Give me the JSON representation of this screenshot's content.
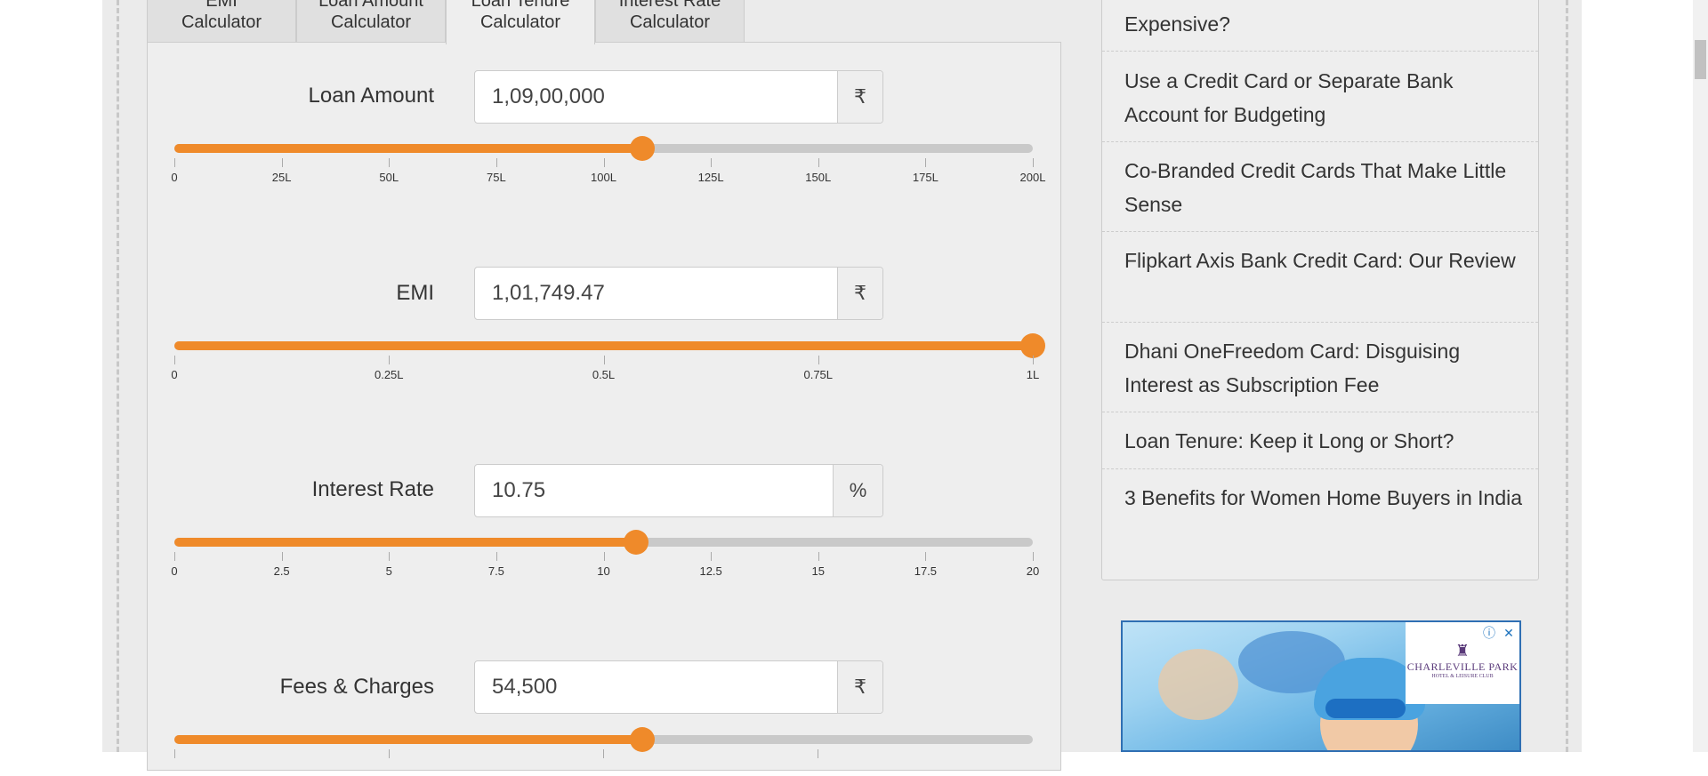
{
  "tabs": [
    {
      "label": "EMI Calculator"
    },
    {
      "label": "Loan Amount Calculator"
    },
    {
      "label": "Loan Tenure Calculator",
      "active": true
    },
    {
      "label": "Interest Rate Calculator"
    }
  ],
  "fields": {
    "loan_amount": {
      "label": "Loan Amount",
      "value": "1,09,00,000",
      "unit": "₹",
      "slider_fraction": 0.545,
      "ticks": [
        "0",
        "25L",
        "50L",
        "75L",
        "100L",
        "125L",
        "150L",
        "175L",
        "200L"
      ]
    },
    "emi": {
      "label": "EMI",
      "value": "1,01,749.47",
      "unit": "₹",
      "slider_fraction": 1.0,
      "ticks": [
        "0",
        "0.25L",
        "0.5L",
        "0.75L",
        "1L"
      ]
    },
    "interest_rate": {
      "label": "Interest Rate",
      "value": "10.75",
      "unit": "%",
      "slider_fraction": 0.5375,
      "ticks": [
        "0",
        "2.5",
        "5",
        "7.5",
        "10",
        "12.5",
        "15",
        "17.5",
        "20"
      ]
    },
    "fees": {
      "label": "Fees & Charges",
      "value": "54,500",
      "unit": "₹",
      "slider_fraction": 0.545
    }
  },
  "sidebar": {
    "items": [
      {
        "label": "Expensive?"
      },
      {
        "label": "Use a Credit Card or Separate Bank Account for Budgeting"
      },
      {
        "label": "Co-Branded Credit Cards That Make Little Sense"
      },
      {
        "label": "Flipkart Axis Bank Credit Card: Our Review"
      },
      {
        "label": "Dhani OneFreedom Card: Disguising Interest as Subscription Fee"
      },
      {
        "label": "Loan Tenure: Keep it Long or Short?"
      },
      {
        "label": "3 Benefits for Women Home Buyers in India"
      }
    ]
  },
  "ad": {
    "brand": "CHARLEVILLE PARK",
    "brand_sub": "HOTEL & LEISURE CLUB",
    "brand_mark": "♜",
    "info_icon": "ⓘ",
    "close_icon": "✕"
  },
  "colors": {
    "accent": "#ef8a2a",
    "track": "#c9c9c9",
    "panel": "#eeeeee"
  }
}
